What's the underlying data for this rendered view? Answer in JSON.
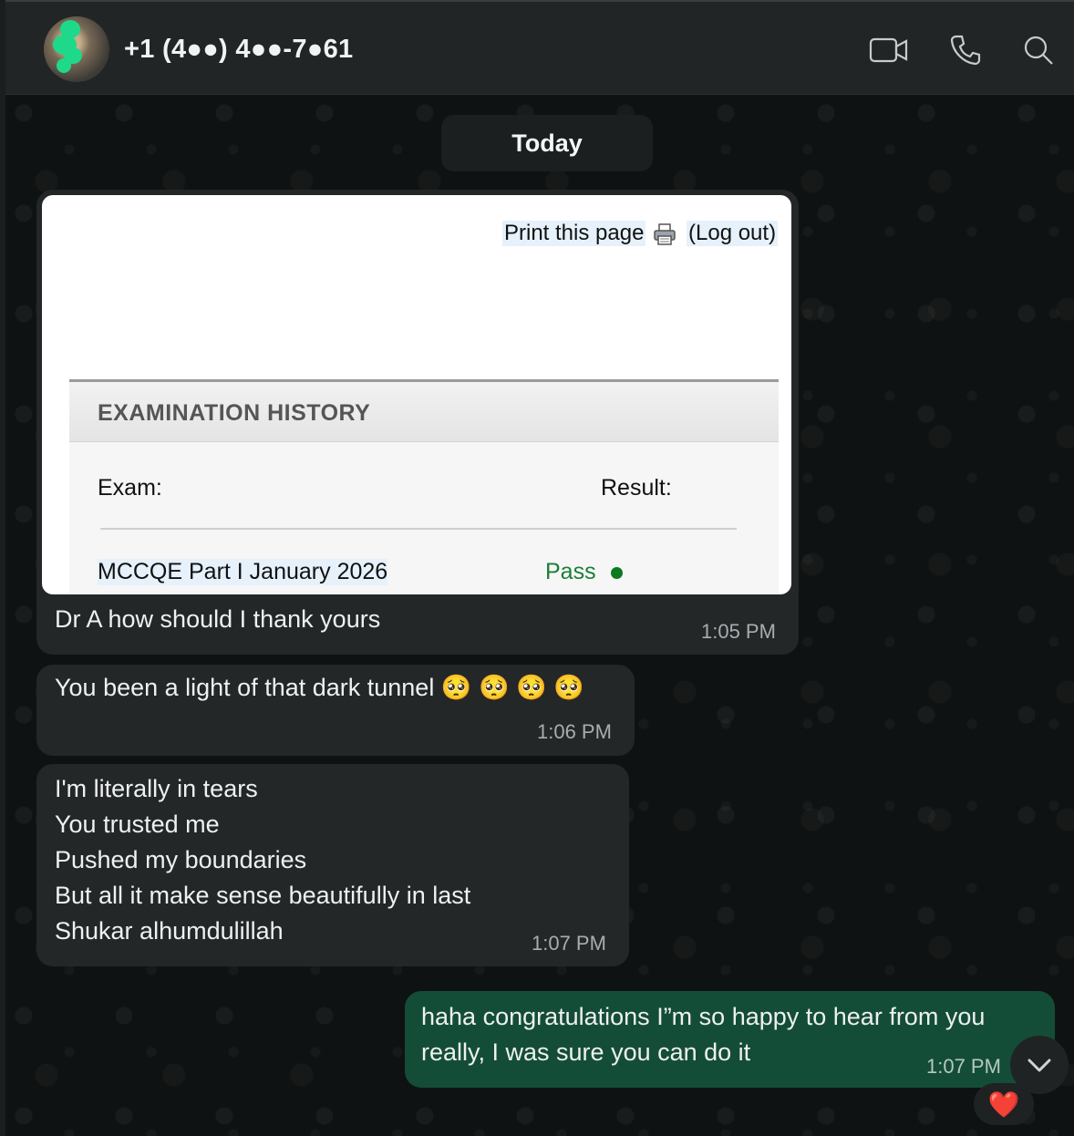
{
  "header": {
    "contact_name": "+1 (4●●) 4●●-7●61",
    "video_icon": "video-camera-icon",
    "call_icon": "phone-icon",
    "search_icon": "search-icon"
  },
  "date_chip": "Today",
  "messages": [
    {
      "direction": "incoming",
      "image": {
        "print_link": "Print this page",
        "logout_link": "(Log out)",
        "section_title": "EXAMINATION HISTORY",
        "col_exam": "Exam:",
        "col_result": "Result:",
        "exam_name": "MCCQE Part I January 2026",
        "exam_result": "Pass"
      },
      "text": "Dr A how should I thank yours",
      "time": "1:05 PM"
    },
    {
      "direction": "incoming",
      "text": "You been a light of that dark tunnel 🥺 🥺 🥺 🥺",
      "time": "1:06 PM"
    },
    {
      "direction": "incoming",
      "lines": [
        "I'm literally in tears",
        "You trusted me",
        "Pushed my boundaries",
        "But all it make sense beautifully in last",
        "Shukar alhumdulillah"
      ],
      "time": "1:07 PM"
    },
    {
      "direction": "outgoing",
      "lines": [
        "haha congratulations I”m so happy to hear from you",
        "really, I was sure you can do it"
      ],
      "time": "1:07 PM",
      "reaction": "❤️"
    }
  ],
  "colors": {
    "header_bg": "#222526",
    "incoming_bubble": "#242728",
    "outgoing_bubble": "#144d37",
    "pass_green": "#1a7f37"
  }
}
